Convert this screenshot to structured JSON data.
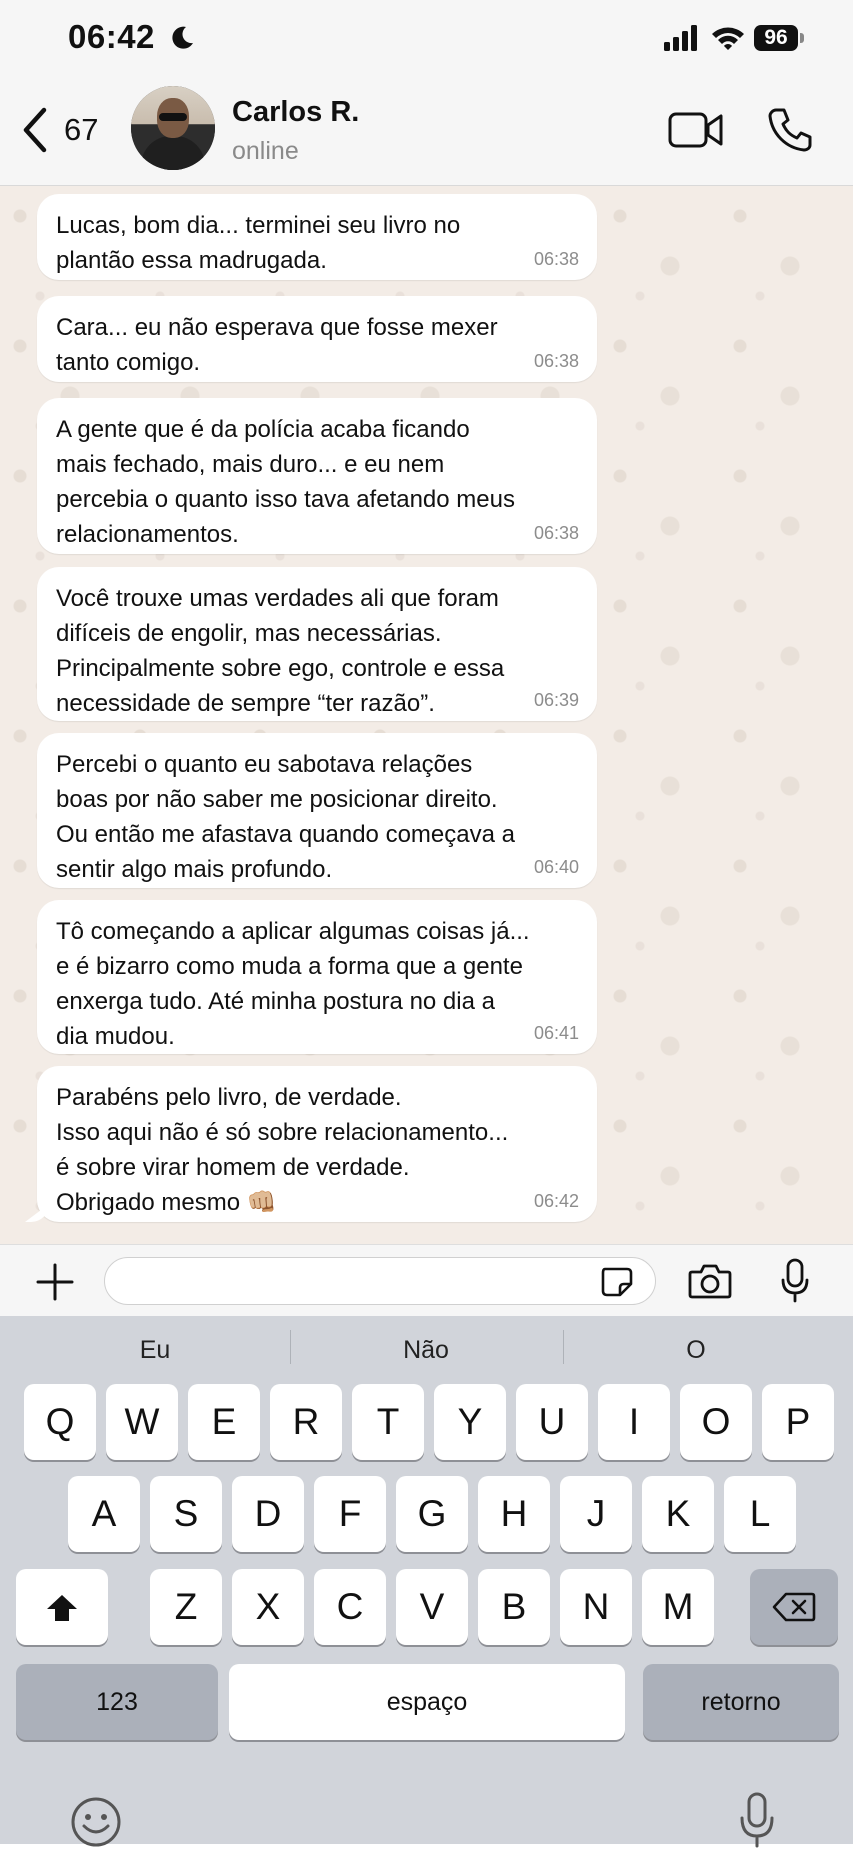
{
  "status_bar": {
    "time": "06:42",
    "battery": "96"
  },
  "header": {
    "back_count": "67",
    "contact_name": "Carlos R.",
    "presence": "online"
  },
  "messages": [
    {
      "text": "Lucas, bom dia... terminei seu livro no\nplantão essa madrugada.",
      "time": "06:38"
    },
    {
      "text": "Cara... eu não esperava que fosse mexer\ntanto comigo.",
      "time": "06:38"
    },
    {
      "text": "A gente que é da polícia acaba ficando\nmais fechado, mais duro... e eu nem\npercebia o quanto isso tava afetando meus\nrelacionamentos.",
      "time": "06:38"
    },
    {
      "text": "Você trouxe umas verdades ali que foram\ndifíceis de engolir, mas necessárias.\nPrincipalmente sobre ego, controle e essa\nnecessidade de sempre “ter razão”.",
      "time": "06:39"
    },
    {
      "text": "Percebi o quanto eu sabotava relações\nboas por não saber me posicionar direito.\nOu então me afastava quando começava a\nsentir algo mais profundo.",
      "time": "06:40"
    },
    {
      "text": "Tô começando a aplicar algumas coisas já...\ne é bizarro como muda a forma que a gente\nenxerga tudo. Até minha postura no dia a\ndia mudou.",
      "time": "06:41"
    },
    {
      "text": "Parabéns pelo livro, de verdade.\nIsso aqui não é só sobre relacionamento...\né sobre virar homem de verdade.\nObrigado mesmo 👊🏼",
      "time": "06:42"
    }
  ],
  "input": {
    "placeholder": ""
  },
  "keyboard": {
    "suggestions": [
      "Eu",
      "Não",
      "O"
    ],
    "row1": [
      "Q",
      "W",
      "E",
      "R",
      "T",
      "Y",
      "U",
      "I",
      "O",
      "P"
    ],
    "row2": [
      "A",
      "S",
      "D",
      "F",
      "G",
      "H",
      "J",
      "K",
      "L"
    ],
    "row3": [
      "Z",
      "X",
      "C",
      "V",
      "B",
      "N",
      "M"
    ],
    "numbers_key": "123",
    "space_key": "espaço",
    "return_key": "retorno"
  },
  "icons": {
    "moon": "moon-icon",
    "signal": "signal-icon",
    "wifi": "wifi-icon",
    "back": "chevron-left-icon",
    "video": "video-call-icon",
    "phone": "phone-icon",
    "plus": "plus-icon",
    "sticker": "sticker-icon",
    "camera": "camera-icon",
    "mic": "microphone-icon",
    "shift": "shift-icon",
    "delete": "backspace-icon",
    "emoji": "emoji-icon",
    "dictation": "dictation-icon"
  }
}
